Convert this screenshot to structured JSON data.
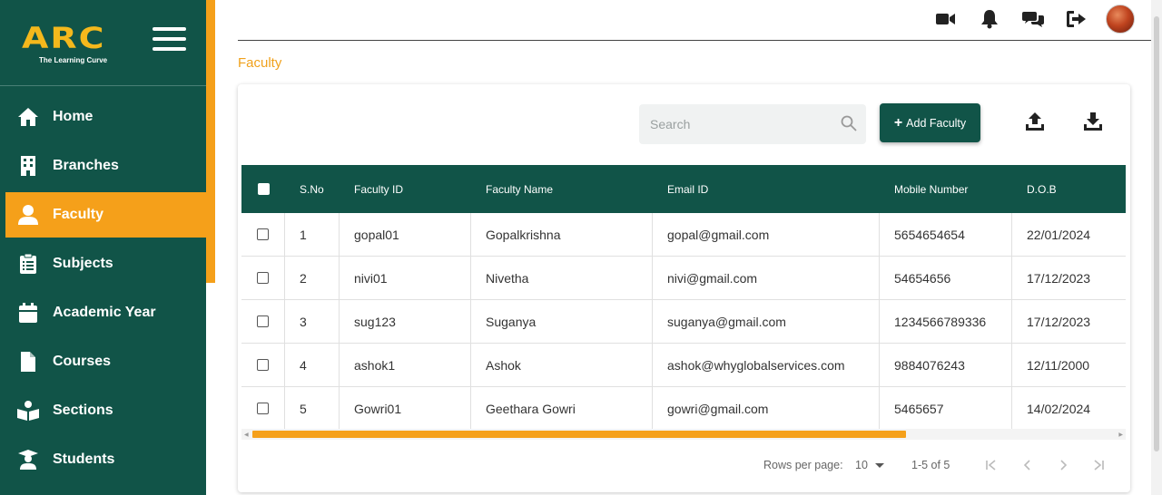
{
  "brand": {
    "logo_text": "ARC",
    "tagline": "The Learning Curve"
  },
  "sidebar": {
    "items": [
      {
        "label": "Home",
        "icon": "home-icon"
      },
      {
        "label": "Branches",
        "icon": "building-icon"
      },
      {
        "label": "Faculty",
        "icon": "user-icon",
        "active": true
      },
      {
        "label": "Subjects",
        "icon": "clipboard-icon"
      },
      {
        "label": "Academic Year",
        "icon": "calendar-icon"
      },
      {
        "label": "Courses",
        "icon": "file-icon"
      },
      {
        "label": "Sections",
        "icon": "reader-icon"
      },
      {
        "label": "Students",
        "icon": "graduate-icon"
      }
    ]
  },
  "topbar": {
    "icons": [
      "video-icon",
      "bell-icon",
      "chat-icon",
      "logout-icon"
    ],
    "avatar": "user-avatar"
  },
  "breadcrumb": "Faculty",
  "toolbar": {
    "search_placeholder": "Search",
    "add_label": "Add Faculty",
    "upload_icon": "upload-icon",
    "download_icon": "download-icon"
  },
  "table": {
    "headers": [
      "S.No",
      "Faculty ID",
      "Faculty Name",
      "Email ID",
      "Mobile Number",
      "D.O.B"
    ],
    "rows": [
      {
        "sno": "1",
        "fid": "gopal01",
        "name": "Gopalkrishna",
        "email": "gopal@gmail.com",
        "mobile": "5654654654",
        "dob": "22/01/2024"
      },
      {
        "sno": "2",
        "fid": "nivi01",
        "name": "Nivetha",
        "email": "nivi@gmail.com",
        "mobile": "54654656",
        "dob": "17/12/2023"
      },
      {
        "sno": "3",
        "fid": "sug123",
        "name": "Suganya",
        "email": "suganya@gmail.com",
        "mobile": "1234566789336",
        "dob": "17/12/2023"
      },
      {
        "sno": "4",
        "fid": "ashok1",
        "name": "Ashok",
        "email": "ashok@whyglobalservices.com",
        "mobile": "9884076243",
        "dob": "12/11/2000"
      },
      {
        "sno": "5",
        "fid": "Gowri01",
        "name": "Geethara Gowri",
        "email": "gowri@gmail.com",
        "mobile": "5465657",
        "dob": "14/02/2024"
      }
    ]
  },
  "pagination": {
    "rows_per_page_label": "Rows per page:",
    "rows_per_page": "10",
    "range": "1-5 of 5"
  },
  "colors": {
    "primary": "#115448",
    "accent": "#f5a01a"
  }
}
